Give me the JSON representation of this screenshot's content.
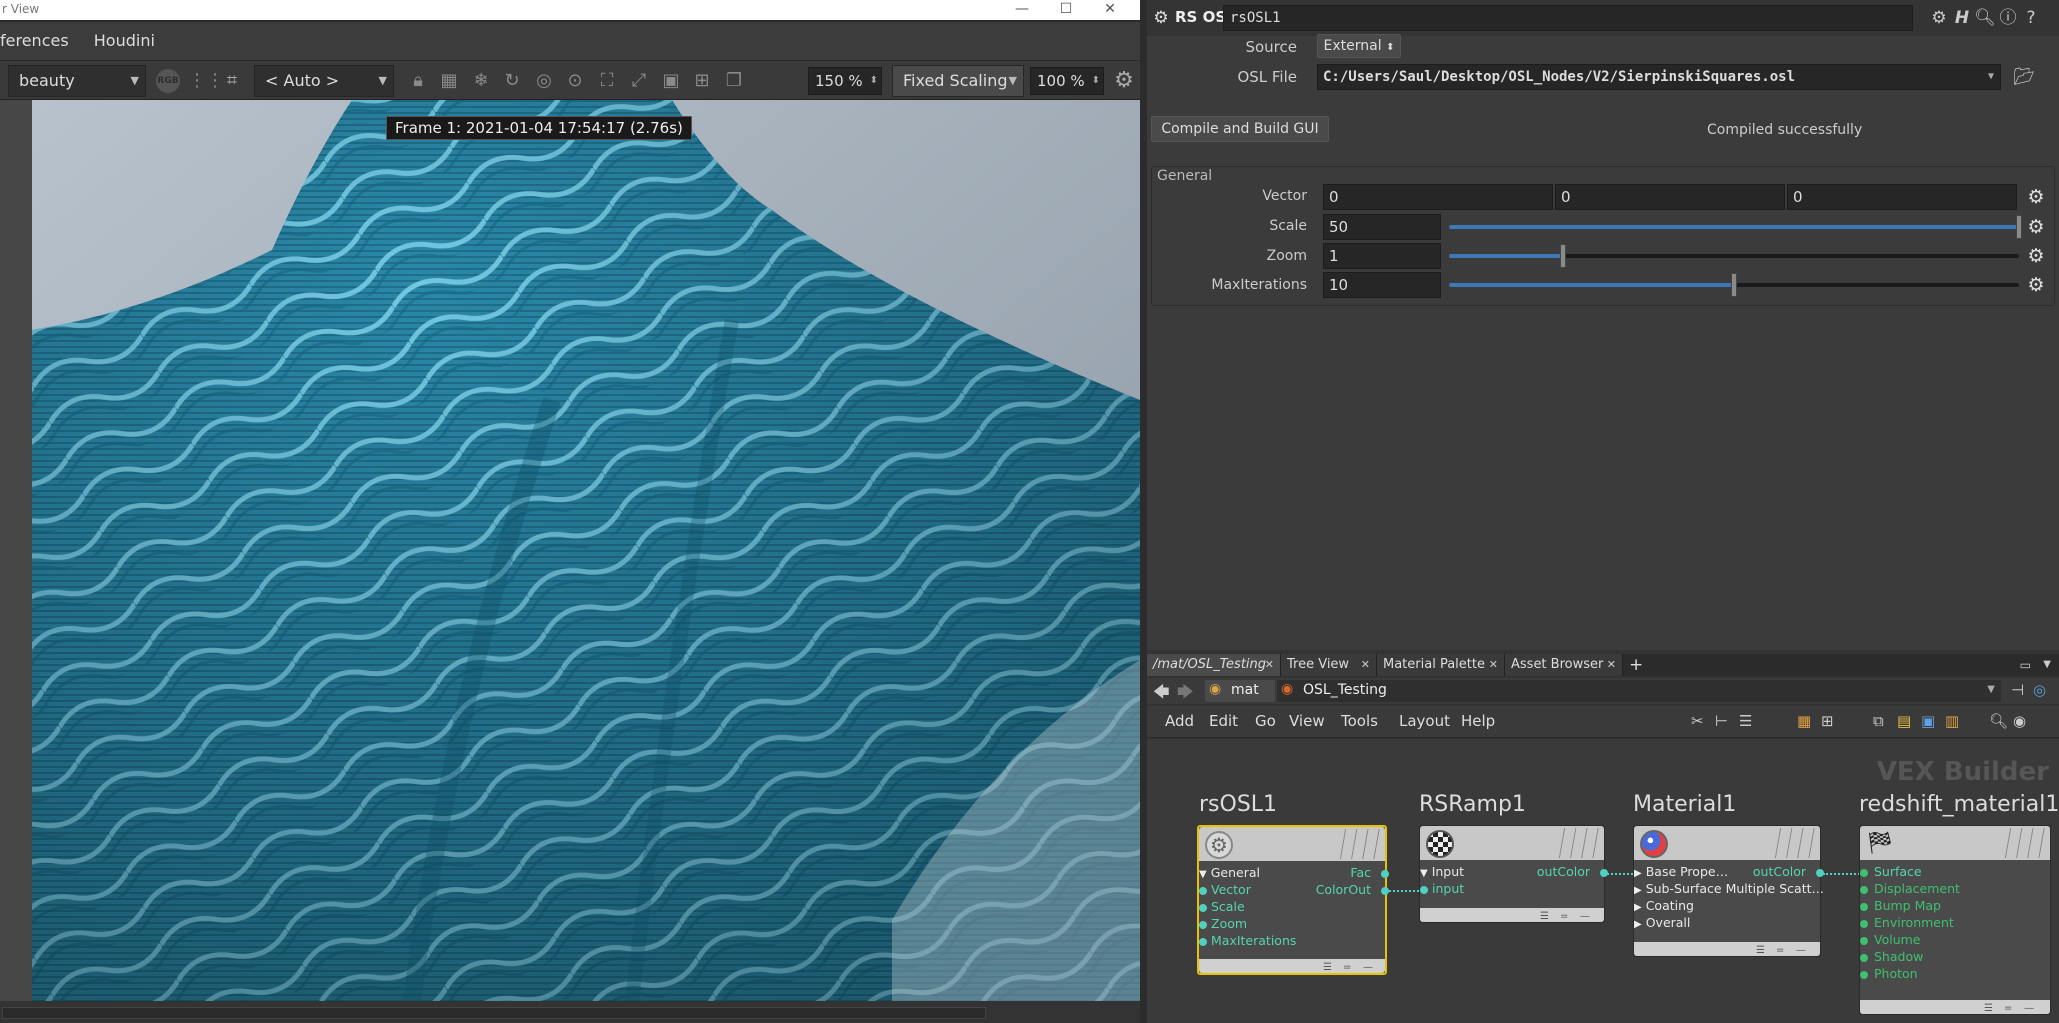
{
  "window": {
    "title": "r View",
    "controls": [
      "—",
      "☐",
      "✕"
    ]
  },
  "menubar": {
    "items": [
      "ferences",
      "Houdini"
    ]
  },
  "viewer": {
    "aov": "beauty",
    "camera": "< Auto >",
    "zoom": "150 %",
    "scaling": "Fixed Scaling",
    "scale_pct": "100 %",
    "frame_label": "Frame  1:  2021-01-04  17:54:17  (2.76s)"
  },
  "params": {
    "node_type": "RS OSL",
    "node_name": "rsOSL1",
    "source_label": "Source",
    "source_value": "External",
    "osl_label": "OSL File",
    "osl_path": "C:/Users/Saul/Desktop/OSL_Nodes/V2/SierpinskiSquares.osl",
    "compile_button": "Compile and Build GUI",
    "compile_status": "Compiled successfully",
    "section": "General",
    "vector_label": "Vector",
    "vector": [
      "0",
      "0",
      "0"
    ],
    "scale_label": "Scale",
    "scale_value": "50",
    "scale_level": 1.0,
    "zoom_label": "Zoom",
    "zoom_value": "1",
    "zoom_level": 0.2,
    "maxiter_label": "MaxIterations",
    "maxiter_value": "10",
    "maxiter_level": 0.5
  },
  "network": {
    "tabs": [
      "/mat/OSL_Testing",
      "Tree View",
      "Material Palette",
      "Asset Browser"
    ],
    "path": [
      "mat",
      "OSL_Testing"
    ],
    "menu": [
      "Add",
      "Edit",
      "Go",
      "View",
      "Tools",
      "Layout",
      "Help"
    ],
    "context_label": "VEX Builder",
    "nodes": {
      "rsosl": {
        "title": "rsOSL1",
        "inputs": [
          "General",
          "Vector",
          "Scale",
          "Zoom",
          "MaxIterations"
        ],
        "outputs": [
          "Fac",
          "ColorOut"
        ]
      },
      "ramp": {
        "title": "RSRamp1",
        "inputs": [
          "Input",
          "input"
        ],
        "outputs": [
          "outColor"
        ]
      },
      "material": {
        "title": "Material1",
        "inputs": [
          "Base Prope…",
          "Sub-Surface Multiple Scatt…",
          "Coating",
          "Overall"
        ],
        "outputs": [
          "outColor"
        ]
      },
      "rsmat": {
        "title": "redshift_material1",
        "inputs": [
          "Surface",
          "Displacement",
          "Bump Map",
          "Environment",
          "Volume",
          "Shadow",
          "Photon"
        ]
      }
    }
  }
}
